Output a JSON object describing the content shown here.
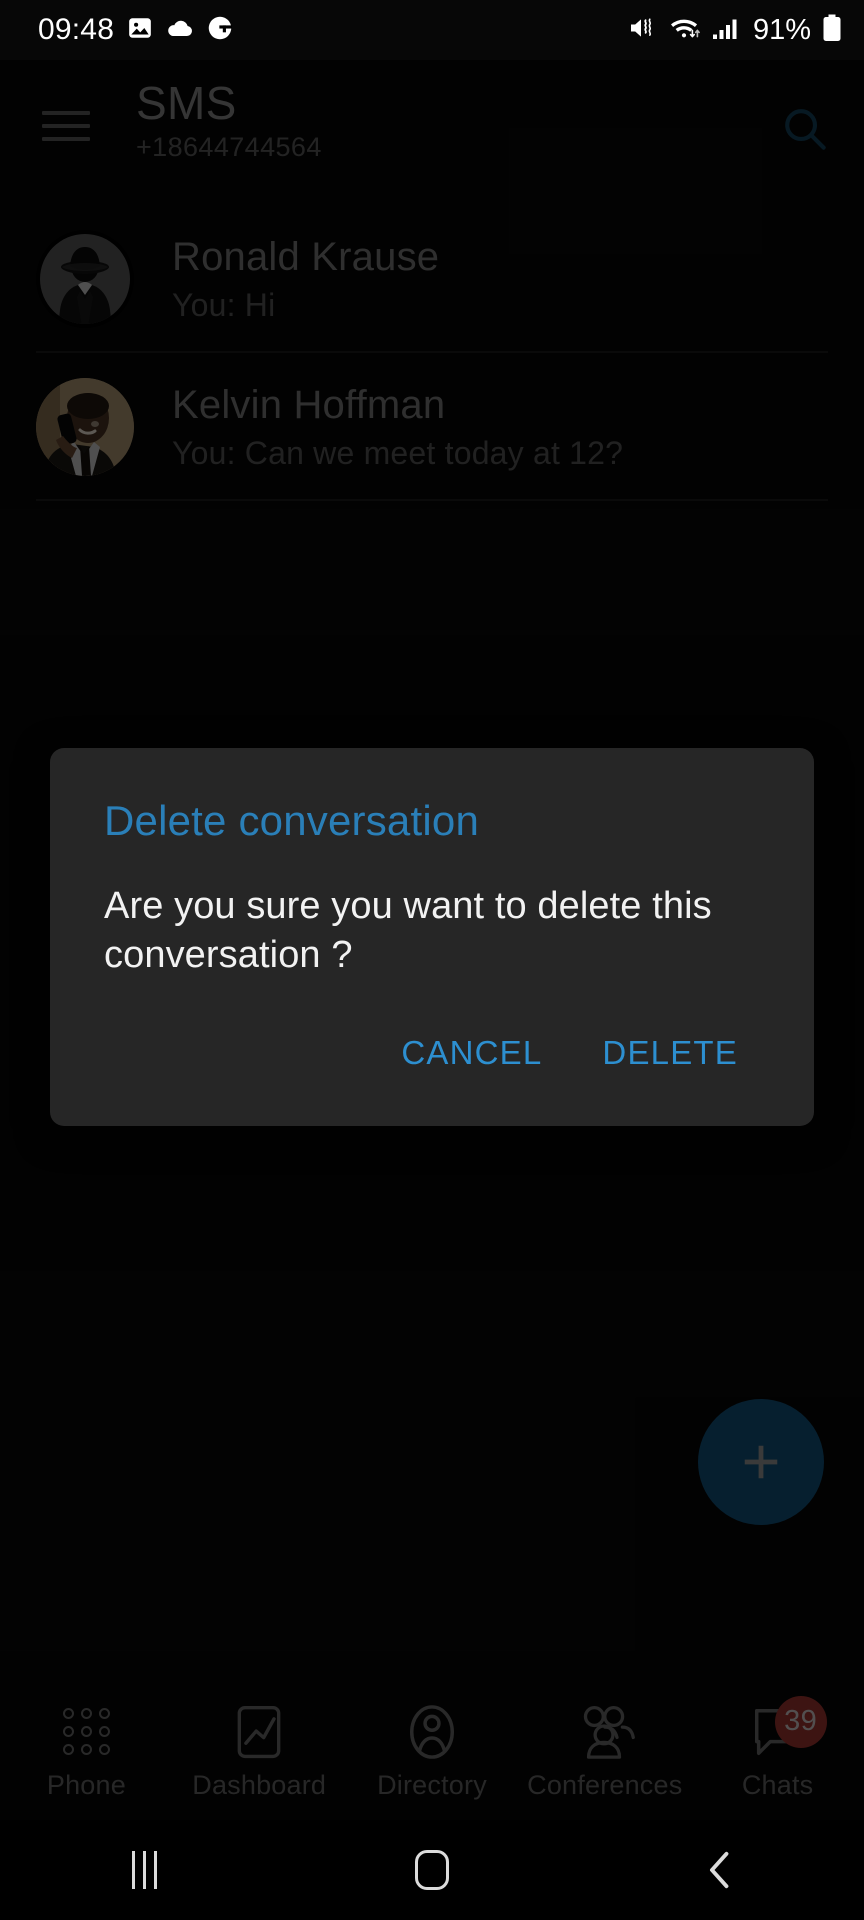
{
  "status_bar": {
    "clock": "09:48",
    "icons_left": [
      "image-icon",
      "cloud-icon",
      "grammarly-icon"
    ],
    "icons_right": [
      "mute-vibrate-icon",
      "wifi-icon",
      "cellular-signal-icon"
    ],
    "battery_percent": "91%",
    "battery_icon": "battery-icon"
  },
  "app_bar": {
    "menu_icon": "hamburger-menu-icon",
    "title": "SMS",
    "subtitle": "+18644744564",
    "search_icon": "search-icon"
  },
  "conversations": [
    {
      "name": "Ronald Krause",
      "preview": "You: Hi",
      "avatar_type": "anonymous-silhouette"
    },
    {
      "name": "Kelvin Hoffman",
      "preview": "You: Can we meet today at 12?",
      "avatar_type": "photo-portrait"
    }
  ],
  "dialog": {
    "title": "Delete conversation",
    "message": "Are you sure you want to delete this conversation ?",
    "cancel_label": "CANCEL",
    "delete_label": "DELETE",
    "title_color": "#2a7fb8",
    "action_color": "#2d8fd0",
    "background": "#262626"
  },
  "fab": {
    "icon": "plus-icon",
    "color": "#11537d"
  },
  "bottom_nav": {
    "items": [
      {
        "label": "Phone",
        "icon": "dialpad-icon"
      },
      {
        "label": "Dashboard",
        "icon": "chart-icon"
      },
      {
        "label": "Directory",
        "icon": "person-outline-icon"
      },
      {
        "label": "Conferences",
        "icon": "people-group-icon"
      },
      {
        "label": "Chats",
        "icon": "chat-bubble-icon",
        "badge": "39"
      }
    ],
    "badge_color": "#a03530"
  },
  "android_nav": {
    "recents_label": "recents-button",
    "home_label": "home-button",
    "back_label": "back-button"
  }
}
